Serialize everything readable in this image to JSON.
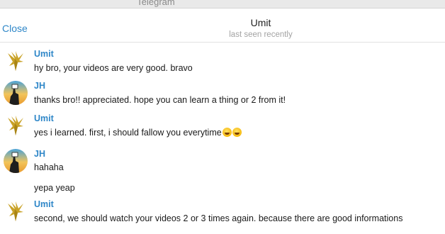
{
  "window": {
    "title": "Telegram"
  },
  "header": {
    "close_label": "Close",
    "peer_name": "Umit",
    "peer_status": "last seen recently"
  },
  "messages": [
    {
      "sender": "Umit",
      "text": "hy bro, your videos are very good. bravo"
    },
    {
      "sender": "JH",
      "text": "thanks bro!! appreciated. hope you can learn a thing or 2 from it!"
    },
    {
      "sender": "Umit",
      "text": "yes i learned. first, i should fallow you everytime"
    },
    {
      "sender": "JH",
      "text": "hahaha"
    },
    {
      "text": "yepa yeap"
    },
    {
      "sender": "Umit",
      "text": "second, we should watch your videos 2 or 3 times again. because there are good informations"
    }
  ],
  "emoji": [
    "tears-of-joy-emoji",
    "tears-of-joy-emoji"
  ],
  "colors": {
    "accent": "#2f87c8",
    "muted": "#a3a3a3"
  }
}
